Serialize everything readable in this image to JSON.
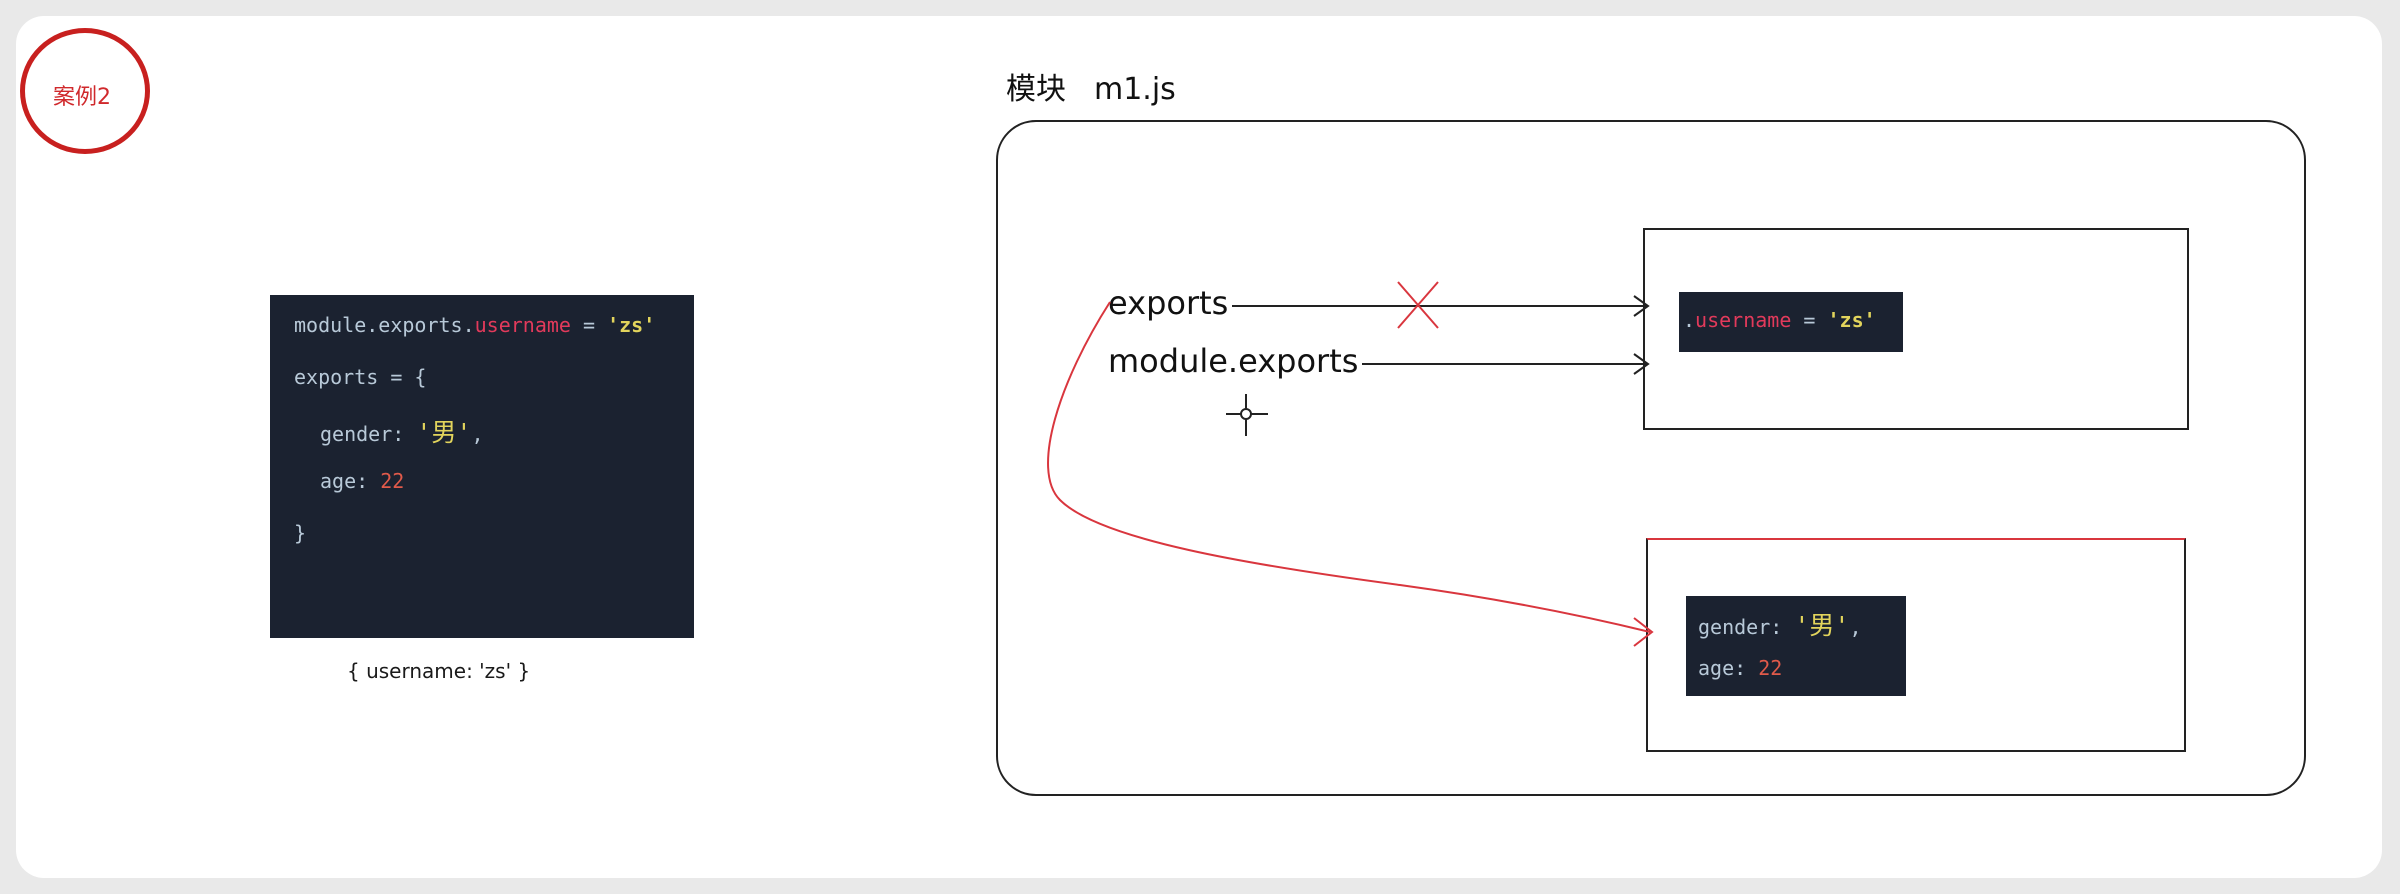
{
  "badge": {
    "label": "案例2"
  },
  "code": {
    "line1": {
      "prefix": "module.exports.",
      "prop": "username",
      "op": " = ",
      "value": "'zs'"
    },
    "line2": "exports = {",
    "line3": {
      "key": "gender: ",
      "value": "'男'",
      "suffix": ","
    },
    "line4": {
      "key": "age: ",
      "value": "22"
    },
    "line5": "}"
  },
  "result_caption": "{ username: 'zs' }",
  "module": {
    "label": "模块",
    "filename": "m1.js"
  },
  "refs": {
    "exports": "exports",
    "module_exports": "module.exports"
  },
  "box1_snippet": {
    "prefix": ".",
    "prop": "username",
    "op": " = ",
    "value": "'zs'"
  },
  "box2_snippet": {
    "line1_key": "gender: ",
    "line1_value": "'男'",
    "line1_suffix": ",",
    "line2_key": "age: ",
    "line2_value": "22"
  },
  "colors": {
    "badge": "#c8201f",
    "arrow_red": "#d9363e",
    "code_bg": "#1b2230"
  }
}
